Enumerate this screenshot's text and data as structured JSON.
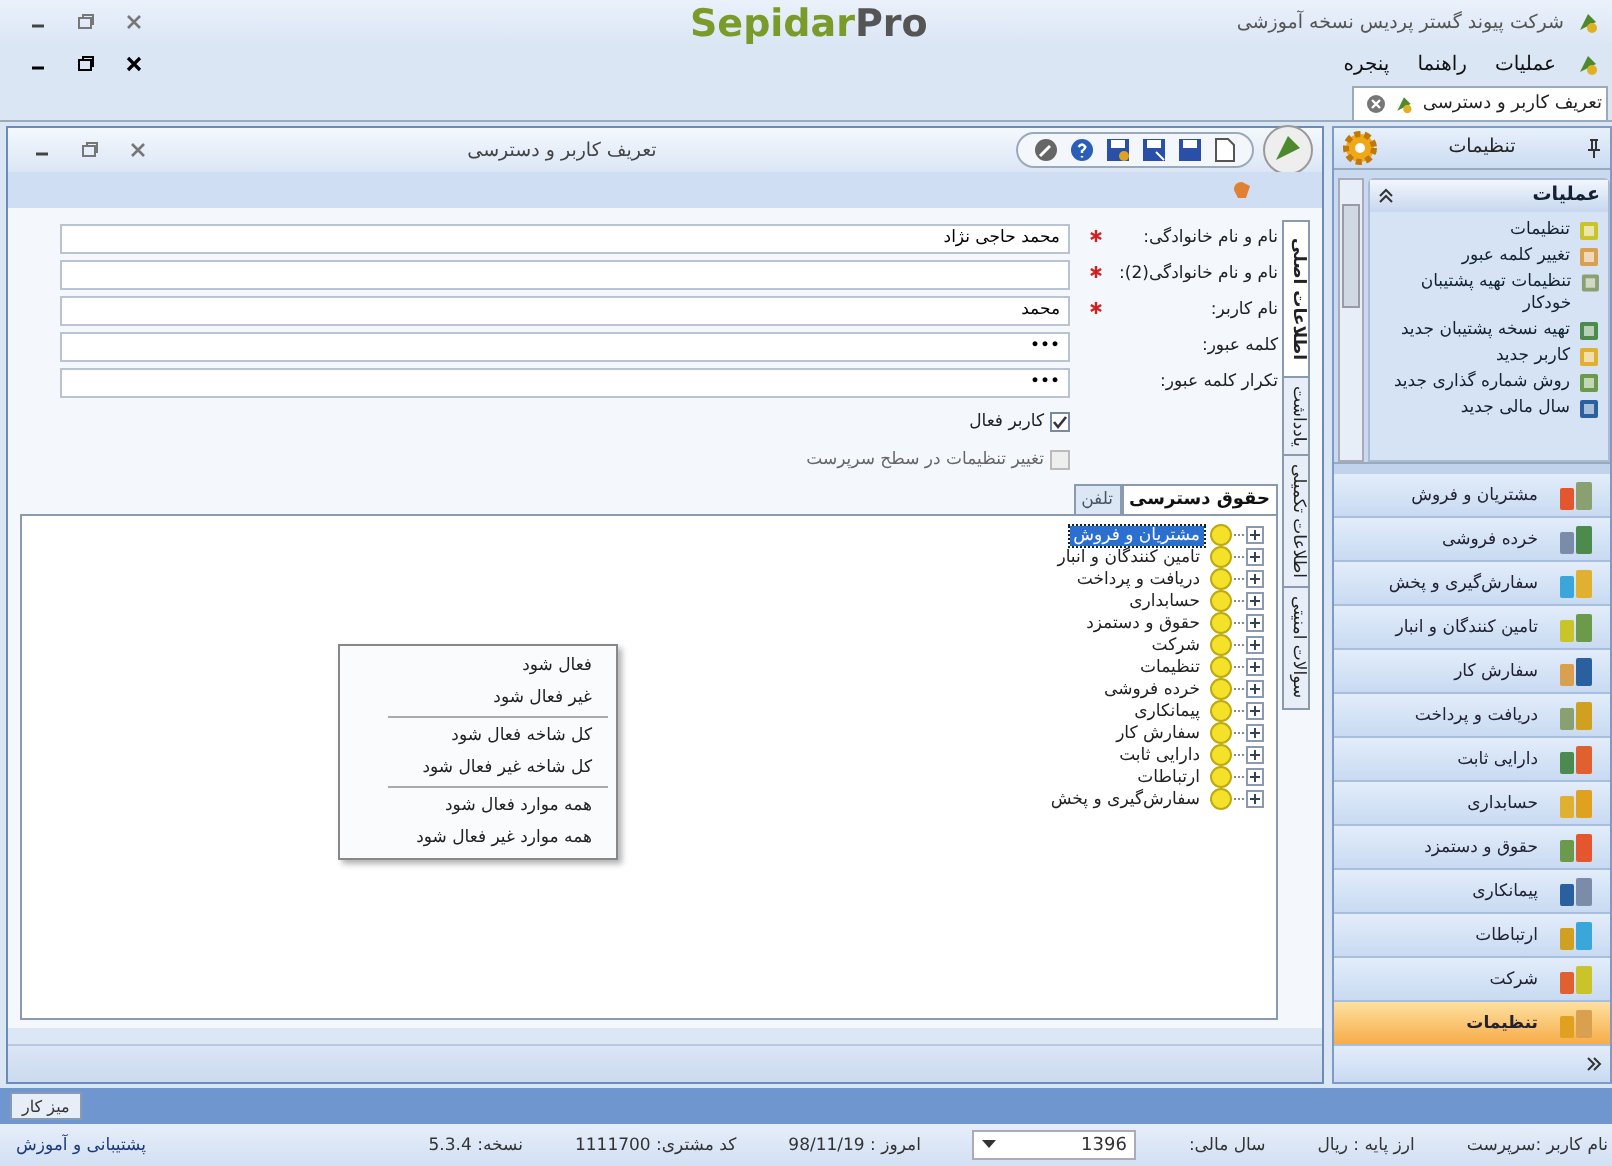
{
  "app_title": "شرکت پیوند گستر پردیس نسخه آموزشی",
  "logo": {
    "brand": "Sepidar",
    "suffix": "Pro"
  },
  "menu": [
    "عملیات",
    "راهنما",
    "پنجره"
  ],
  "doc_tabs": [
    {
      "label": "تعریف کاربر و دسترسی",
      "selected": true
    }
  ],
  "child_window": {
    "title": "تعریف کاربر و دسترسی",
    "vertical_tabs": [
      {
        "label": "اطلاعات اصلی",
        "selected": true
      },
      {
        "label": "یادداشت",
        "selected": false
      },
      {
        "label": "اطلاعات تکمیلی",
        "selected": false
      },
      {
        "label": "سوالات امنیتی",
        "selected": false
      }
    ],
    "fields": [
      {
        "label": "نام و نام خانوادگی:",
        "required": true,
        "value": "محمد حاجی نژاد"
      },
      {
        "label": "نام و نام خانوادگی(2):",
        "required": true
      },
      {
        "label": "نام کاربر:",
        "required": true,
        "value": "محمد"
      },
      {
        "label": "کلمه عبور:",
        "required": false,
        "value": "•••"
      },
      {
        "label": "تکرار کلمه عبور:",
        "required": false,
        "value": "•••"
      }
    ],
    "checkboxes": [
      {
        "label": "کاربر فعال",
        "checked": true,
        "disabled": false
      },
      {
        "label": "تغییر تنظیمات در سطح سرپرست",
        "checked": false,
        "disabled": true
      }
    ],
    "sub_tabs": [
      {
        "label": "حقوق دسترسی",
        "selected": true
      },
      {
        "label": "تلفن",
        "selected": false
      }
    ],
    "tree": [
      {
        "label": "مشتریان و فروش",
        "selected": true
      },
      {
        "label": "تامین کنندگان و انبار",
        "selected": false
      },
      {
        "label": "دریافت و پرداخت",
        "selected": false
      },
      {
        "label": "حسابداری",
        "selected": false
      },
      {
        "label": "حقوق و دستمزد",
        "selected": false
      },
      {
        "label": "شرکت",
        "selected": false
      },
      {
        "label": "تنظیمات",
        "selected": false
      },
      {
        "label": "خرده فروشی",
        "selected": false
      },
      {
        "label": "پیمانکاری",
        "selected": false
      },
      {
        "label": "سفارش کار",
        "selected": false
      },
      {
        "label": "دارایی ثابت",
        "selected": false
      },
      {
        "label": "ارتباطات",
        "selected": false
      },
      {
        "label": "سفارش‌گیری و پخش",
        "selected": false
      }
    ],
    "context_menu": [
      {
        "items": [
          "فعال شود",
          "غیر فعال شود"
        ]
      },
      {
        "items": [
          "کل شاخه فعال شود",
          "کل شاخه غیر فعال شود"
        ]
      },
      {
        "items": [
          "همه موارد فعال شود",
          "همه موارد غیر فعال شود"
        ]
      }
    ]
  },
  "sidebar": {
    "title": "تنظیمات",
    "section": {
      "title": "عملیات",
      "expanded": true,
      "items": [
        "تنظیمات",
        "تغییر کلمه عبور",
        "تنظیمات تهیه پشتیبان خودکار",
        "تهیه نسخه پشتیبان جدید",
        "کاربر جدید",
        "روش شماره گذاری جدید",
        "سال مالی جدید"
      ]
    },
    "nav": [
      {
        "label": "مشتریان و فروش",
        "selected": false
      },
      {
        "label": "خرده فروشی",
        "selected": false
      },
      {
        "label": "سفارش‌گیری و پخش",
        "selected": false
      },
      {
        "label": "تامین کنندگان و انبار",
        "selected": false
      },
      {
        "label": "سفارش کار",
        "selected": false
      },
      {
        "label": "دریافت و پرداخت",
        "selected": false
      },
      {
        "label": "دارایی ثابت",
        "selected": false
      },
      {
        "label": "حسابداری",
        "selected": false
      },
      {
        "label": "حقوق و دستمزد",
        "selected": false
      },
      {
        "label": "پیمانکاری",
        "selected": false
      },
      {
        "label": "ارتباطات",
        "selected": false
      },
      {
        "label": "شرکت",
        "selected": false
      },
      {
        "label": "تنظیمات",
        "selected": true
      }
    ]
  },
  "taskbar": {
    "button": "میز کار"
  },
  "status_bar": {
    "user": "نام کاربر :سرپرست",
    "currency": "ارز پایه : ریال",
    "fiscal_year_label": "سال مالی:",
    "fiscal_year": "1396",
    "today": "امروز : 98/11/19",
    "customer_code": "کد مشتری: 1111700",
    "version": "نسخه: 5.3.4",
    "support": "پشتیبانی و آموزش"
  }
}
